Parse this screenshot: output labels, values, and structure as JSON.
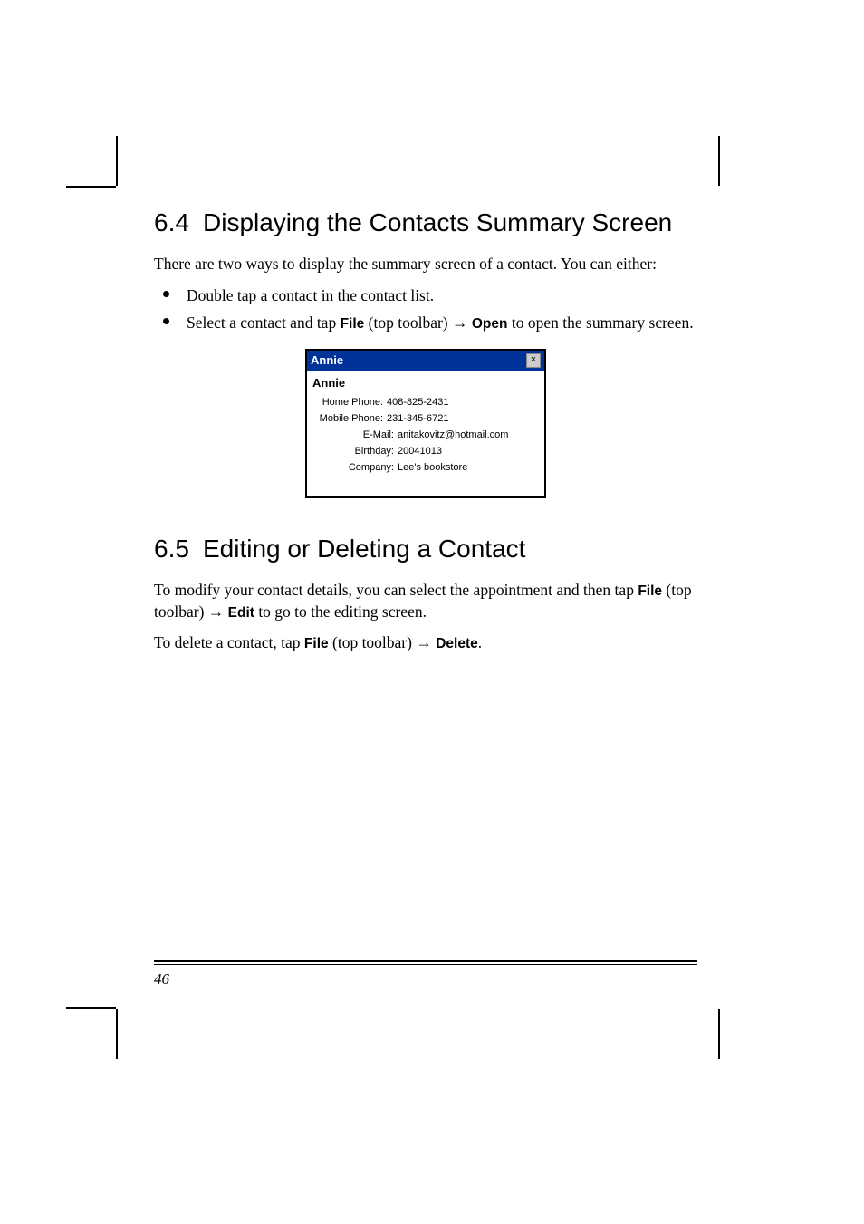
{
  "section64": {
    "num": "6.4",
    "title": "Displaying the Contacts Summary Screen",
    "intro": "There are two ways to display the summary screen of a contact. You can either:",
    "bullet1": "Double tap a contact in the contact list.",
    "bullet2_a": "Select a contact and tap ",
    "bullet2_file": "File",
    "bullet2_b": " (top toolbar) ",
    "bullet2_open": "Open",
    "bullet2_c": " to open the summary screen."
  },
  "shot": {
    "title": "Annie",
    "close": "×",
    "name": "Annie",
    "rows": {
      "home_lbl": "Home Phone:",
      "home_val": "408-825-2431",
      "mobile_lbl": "Mobile Phone:",
      "mobile_val": "231-345-6721",
      "email_lbl": "E-Mail:",
      "email_val": "anitakovitz@hotmail.com",
      "bday_lbl": "Birthday:",
      "bday_val": "20041013",
      "comp_lbl": "Company:",
      "comp_val": "Lee's bookstore"
    }
  },
  "section65": {
    "num": "6.5",
    "title": "Editing or Deleting a Contact",
    "p1_a": "To modify your contact details, you can select the appointment and then tap ",
    "p1_file": "File",
    "p1_b": " (top toolbar) ",
    "p1_edit": "Edit",
    "p1_c": " to go to the editing screen.",
    "p2_a": "To delete a contact, tap ",
    "p2_file": "File",
    "p2_b": " (top toolbar) ",
    "p2_delete": "Delete",
    "p2_c": "."
  },
  "arrow": "→",
  "page_number": "46"
}
